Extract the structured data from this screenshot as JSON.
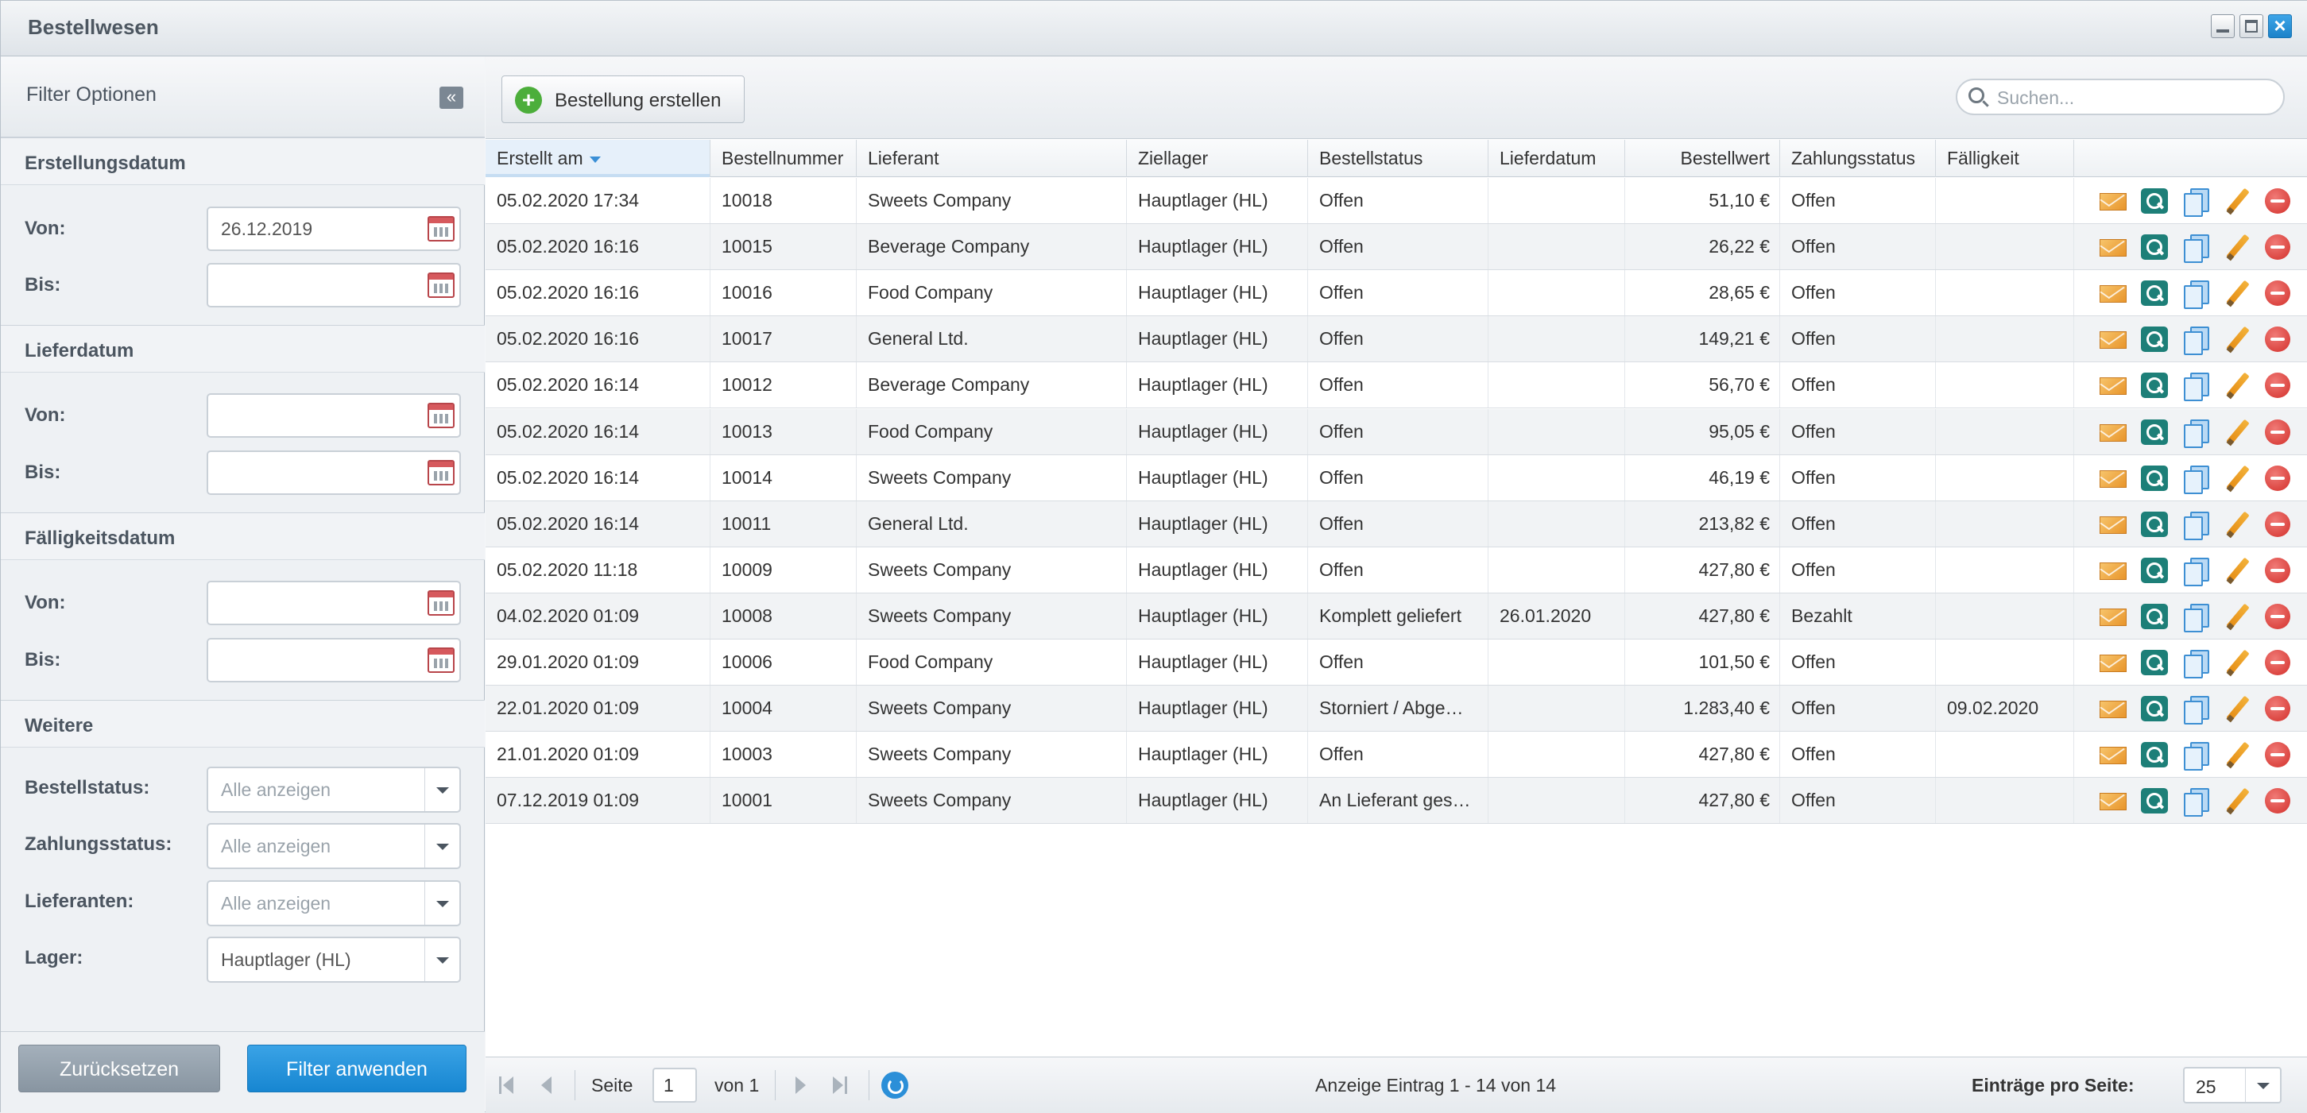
{
  "window": {
    "title": "Bestellwesen"
  },
  "sidebar": {
    "title": "Filter Optionen",
    "sections": {
      "erstellung": {
        "title": "Erstellungsdatum",
        "von_label": "Von:",
        "von_value": "26.12.2019",
        "bis_label": "Bis:",
        "bis_value": ""
      },
      "liefer": {
        "title": "Lieferdatum",
        "von_label": "Von:",
        "von_value": "",
        "bis_label": "Bis:",
        "bis_value": ""
      },
      "faellig": {
        "title": "Fälligkeitsdatum",
        "von_label": "Von:",
        "von_value": "",
        "bis_label": "Bis:",
        "bis_value": ""
      },
      "weitere": {
        "title": "Weitere",
        "bestellstatus_label": "Bestellstatus:",
        "bestellstatus_value": "Alle anzeigen",
        "zahlungsstatus_label": "Zahlungsstatus:",
        "zahlungsstatus_value": "Alle anzeigen",
        "lieferanten_label": "Lieferanten:",
        "lieferanten_value": "Alle anzeigen",
        "lager_label": "Lager:",
        "lager_value": "Hauptlager (HL)"
      }
    },
    "reset_label": "Zurücksetzen",
    "apply_label": "Filter anwenden"
  },
  "toolbar": {
    "create_label": "Bestellung erstellen",
    "search_placeholder": "Suchen..."
  },
  "columns": [
    "Erstellt am",
    "Bestellnummer",
    "Lieferant",
    "Ziellager",
    "Bestellstatus",
    "Lieferdatum",
    "Bestellwert",
    "Zahlungsstatus",
    "Fälligkeit"
  ],
  "rows": [
    [
      "05.02.2020 17:34",
      "10018",
      "Sweets Company",
      "Hauptlager (HL)",
      "Offen",
      "",
      "51,10 €",
      "Offen",
      ""
    ],
    [
      "05.02.2020 16:16",
      "10015",
      "Beverage Company",
      "Hauptlager (HL)",
      "Offen",
      "",
      "26,22 €",
      "Offen",
      ""
    ],
    [
      "05.02.2020 16:16",
      "10016",
      "Food Company",
      "Hauptlager (HL)",
      "Offen",
      "",
      "28,65 €",
      "Offen",
      ""
    ],
    [
      "05.02.2020 16:16",
      "10017",
      "General Ltd.",
      "Hauptlager (HL)",
      "Offen",
      "",
      "149,21 €",
      "Offen",
      ""
    ],
    [
      "05.02.2020 16:14",
      "10012",
      "Beverage Company",
      "Hauptlager (HL)",
      "Offen",
      "",
      "56,70 €",
      "Offen",
      ""
    ],
    [
      "05.02.2020 16:14",
      "10013",
      "Food Company",
      "Hauptlager (HL)",
      "Offen",
      "",
      "95,05 €",
      "Offen",
      ""
    ],
    [
      "05.02.2020 16:14",
      "10014",
      "Sweets Company",
      "Hauptlager (HL)",
      "Offen",
      "",
      "46,19 €",
      "Offen",
      ""
    ],
    [
      "05.02.2020 16:14",
      "10011",
      "General Ltd.",
      "Hauptlager (HL)",
      "Offen",
      "",
      "213,82 €",
      "Offen",
      ""
    ],
    [
      "05.02.2020 11:18",
      "10009",
      "Sweets Company",
      "Hauptlager (HL)",
      "Offen",
      "",
      "427,80 €",
      "Offen",
      ""
    ],
    [
      "04.02.2020 01:09",
      "10008",
      "Sweets Company",
      "Hauptlager (HL)",
      "Komplett geliefert",
      "26.01.2020",
      "427,80 €",
      "Bezahlt",
      ""
    ],
    [
      "29.01.2020 01:09",
      "10006",
      "Food Company",
      "Hauptlager (HL)",
      "Offen",
      "",
      "101,50 €",
      "Offen",
      ""
    ],
    [
      "22.01.2020 01:09",
      "10004",
      "Sweets Company",
      "Hauptlager (HL)",
      "Storniert / Abge…",
      "",
      "1.283,40 €",
      "Offen",
      "09.02.2020"
    ],
    [
      "21.01.2020 01:09",
      "10003",
      "Sweets Company",
      "Hauptlager (HL)",
      "Offen",
      "",
      "427,80 €",
      "Offen",
      ""
    ],
    [
      "07.12.2019 01:09",
      "10001",
      "Sweets Company",
      "Hauptlager (HL)",
      "An Lieferant ges…",
      "",
      "427,80 €",
      "Offen",
      ""
    ]
  ],
  "pager": {
    "page_label": "Seite",
    "page_value": "1",
    "of_label": "von 1",
    "info": "Anzeige Eintrag 1 - 14 von 14",
    "per_page_label": "Einträge pro Seite:",
    "per_page_value": "25"
  }
}
